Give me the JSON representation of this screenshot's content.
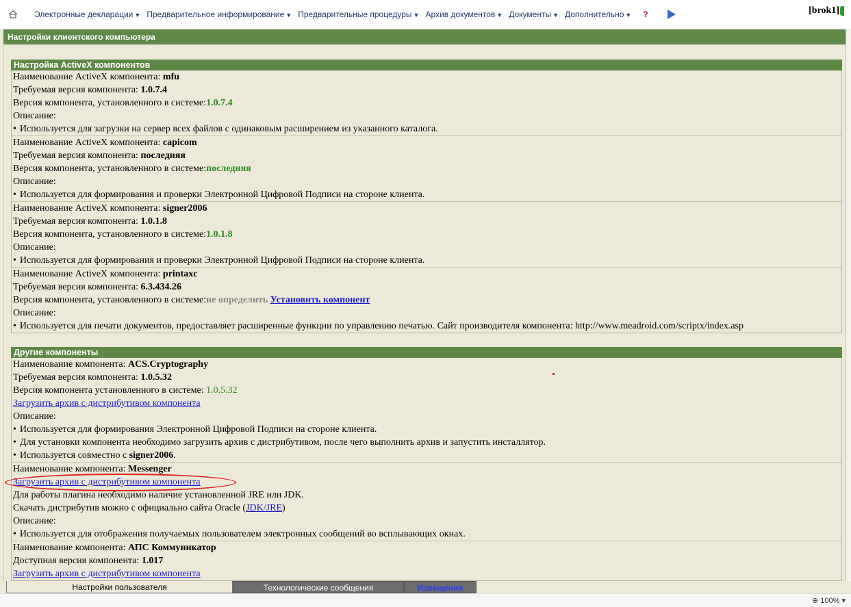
{
  "topbar": {
    "menus": [
      "Электронные декларации",
      "Предварительное информирование",
      "Предварительные процедуры",
      "Архив документов",
      "Документы",
      "Дополнительно"
    ],
    "help": "?",
    "user": "[brok1]"
  },
  "page_title": "Настройки клиентского компьютера",
  "activex": {
    "header": "Настройка ActiveX компонентов",
    "name_label": "Наименование ActiveX компонента: ",
    "required_label": "Требуемая версия компонента: ",
    "installed_label": "Версия компонента, установленного в системе:",
    "desc_label": "Описание:",
    "components": [
      {
        "name": "mfu",
        "required": "1.0.7.4",
        "installed": "1.0.7.4",
        "description": "Используется для загрузки на сервер всех файлов с одинаковым расширением из указанного каталога."
      },
      {
        "name": "capicom",
        "required": "последняя",
        "installed": "последняя",
        "description": "Используется для формирования и проверки Электронной Цифровой Подписи на стороне клиента."
      },
      {
        "name": "signer2006",
        "required": "1.0.1.8",
        "installed": "1.0.1.8",
        "description": "Используется для формирования и проверки Электронной Цифровой Подписи на стороне клиента."
      },
      {
        "name": "printaxc",
        "required": "6.3.434.26",
        "installed": "не определить",
        "install_link": "Установить компонент",
        "description": "Используется для печати документов, предоставляет расширенные функции по управлению печатью. Сайт производителя компонента: http://www.meadroid.com/scriptx/index.asp"
      }
    ]
  },
  "other": {
    "header": "Другие компоненты",
    "acs": {
      "name_label": "Наименование компонента: ",
      "name": "ACS.Cryptography",
      "required_label": "Требуемая версия компонента: ",
      "required": "1.0.5.32",
      "installed_label": "Версия компонента установленного в системе: ",
      "installed": "1.0.5.32",
      "download": "Загрузить архив с дистрибутивом компонента",
      "desc_label": "Описание:",
      "bullet1": "Используется для формирования Электронной Цифровой Подписи на стороне клиента.",
      "bullet2": "Для установки компонента необходимо загрузить архив с дистрибутивом, после чего выполнить архив и запустить инсталлятор.",
      "bullet3_prefix": "Используется совместно с ",
      "bullet3_bold": "signer2006",
      "bullet3_suffix": "."
    },
    "messenger": {
      "name_label": "Наименование компонента: ",
      "name": "Messenger",
      "download": "Загрузить архив с дистрибутивом компонента",
      "jre_note": "Для работы плагина необходимо наличие установленной JRE или JDK.",
      "oracle_prefix": "Скачать дистрибутив можно с официально сайта Oracle (",
      "oracle_link": "JDK/JRE",
      "oracle_suffix": ")",
      "desc_label": "Описание:",
      "bullet1": "Используется для отображения получаемых пользователем электронных сообщений во всплывающих окнах."
    },
    "aps": {
      "name_label": "Наименование компонента: ",
      "name": "АПС Коммуникатор",
      "available_label": "Доступная версия компонента: ",
      "available": "1.017",
      "download": "Загрузить архив с дистрибутивом компонента"
    }
  },
  "tabs": [
    "Настройки пользователя",
    "Технологические сообщения",
    "Извещения"
  ],
  "status": {
    "zoom": "100%"
  }
}
